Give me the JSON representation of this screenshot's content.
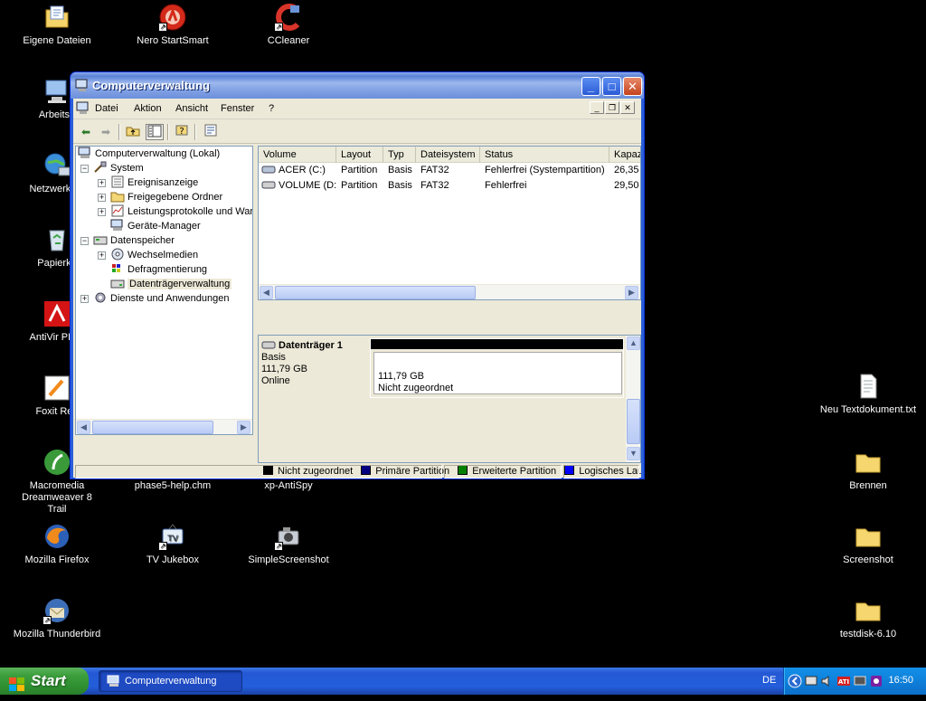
{
  "desktop": {
    "icons_left": [
      {
        "label": "Eigene Dateien"
      },
      {
        "label": "Nero StartSmart"
      },
      {
        "label": "CCleaner"
      },
      {
        "label": "Arbeitsp"
      },
      {
        "label": "Netzwerkum"
      },
      {
        "label": "Papierko"
      },
      {
        "label": "AntiVir PE C"
      },
      {
        "label": "Foxit Rea"
      },
      {
        "label": "Macromedia Dreamweaver 8 Trail"
      },
      {
        "label": "phase5-help.chm"
      },
      {
        "label": "xp-AntiSpy"
      },
      {
        "label": "Mozilla Firefox"
      },
      {
        "label": "TV Jukebox"
      },
      {
        "label": "SimpleScreenshot"
      },
      {
        "label": "Mozilla Thunderbird"
      }
    ],
    "icons_right": [
      {
        "label": "Neu Textdokument.txt"
      },
      {
        "label": "Brennen"
      },
      {
        "label": "Screenshot"
      },
      {
        "label": "testdisk-6.10"
      }
    ]
  },
  "window": {
    "title": "Computerverwaltung",
    "menu": [
      "Datei",
      "Aktion",
      "Ansicht",
      "Fenster",
      "?"
    ],
    "tree": {
      "root": "Computerverwaltung (Lokal)",
      "system": "System",
      "system_children": [
        "Ereignisanzeige",
        "Freigegebene Ordner",
        "Leistungsprotokolle und Warr",
        "Geräte-Manager"
      ],
      "storage": "Datenspeicher",
      "storage_children": [
        "Wechselmedien",
        "Defragmentierung",
        "Datenträgerverwaltung"
      ],
      "services": "Dienste und Anwendungen"
    },
    "volume_table": {
      "columns": [
        "Volume",
        "Layout",
        "Typ",
        "Dateisystem",
        "Status",
        "Kapaz"
      ],
      "rows": [
        [
          "ACER (C:)",
          "Partition",
          "Basis",
          "FAT32",
          "Fehlerfrei (Systempartition)",
          "26,35"
        ],
        [
          "VOLUME (D:)",
          "Partition",
          "Basis",
          "FAT32",
          "Fehlerfrei",
          "29,50"
        ]
      ]
    },
    "disk": {
      "name": "Datenträger 1",
      "type": "Basis",
      "size": "111,79 GB",
      "state": "Online",
      "partition_size": "111,79 GB",
      "partition_status": "Nicht zugeordnet"
    },
    "legend": [
      {
        "label": "Nicht zugeordnet",
        "color": "#000000"
      },
      {
        "label": "Primäre Partition",
        "color": "#000080"
      },
      {
        "label": "Erweiterte Partition",
        "color": "#008000"
      },
      {
        "label": "Logisches Laufwerk",
        "color": "#0000ff"
      }
    ]
  },
  "taskbar": {
    "start_label": "Start",
    "task_button": "Computerverwaltung",
    "language": "DE",
    "clock": "16:50"
  }
}
